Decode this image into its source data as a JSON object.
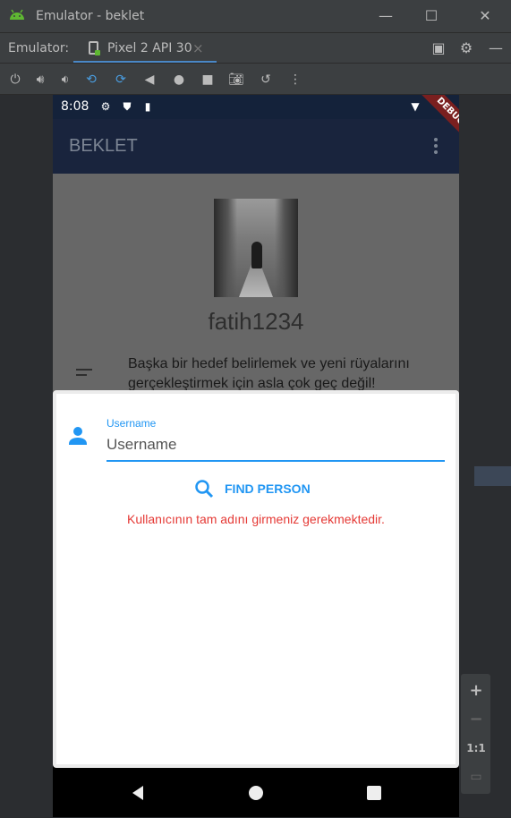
{
  "window": {
    "title": "Emulator - beklet"
  },
  "tabbar": {
    "label": "Emulator:",
    "tab": "Pixel 2 API 30",
    "close": "×"
  },
  "status": {
    "time": "8:08"
  },
  "app": {
    "title": "BEKLET",
    "debug": "DEBUG"
  },
  "profile": {
    "username": "fatih1234",
    "quote": "Başka bir hedef belirlemek ve yeni rüyalarını gerçekleştirmek için asla çok geç değil!"
  },
  "sheet": {
    "field_label": "Username",
    "field_placeholder": "Username",
    "find_button": "FIND PERSON",
    "error": "Kullanıcının tam adını girmeniz gerekmektedir."
  },
  "side": {
    "zoom_in": "+",
    "zoom_out": "−",
    "ratio": "1:1"
  },
  "colors": {
    "accent": "#2196f3",
    "error": "#e53935",
    "appbar": "#19243d"
  }
}
